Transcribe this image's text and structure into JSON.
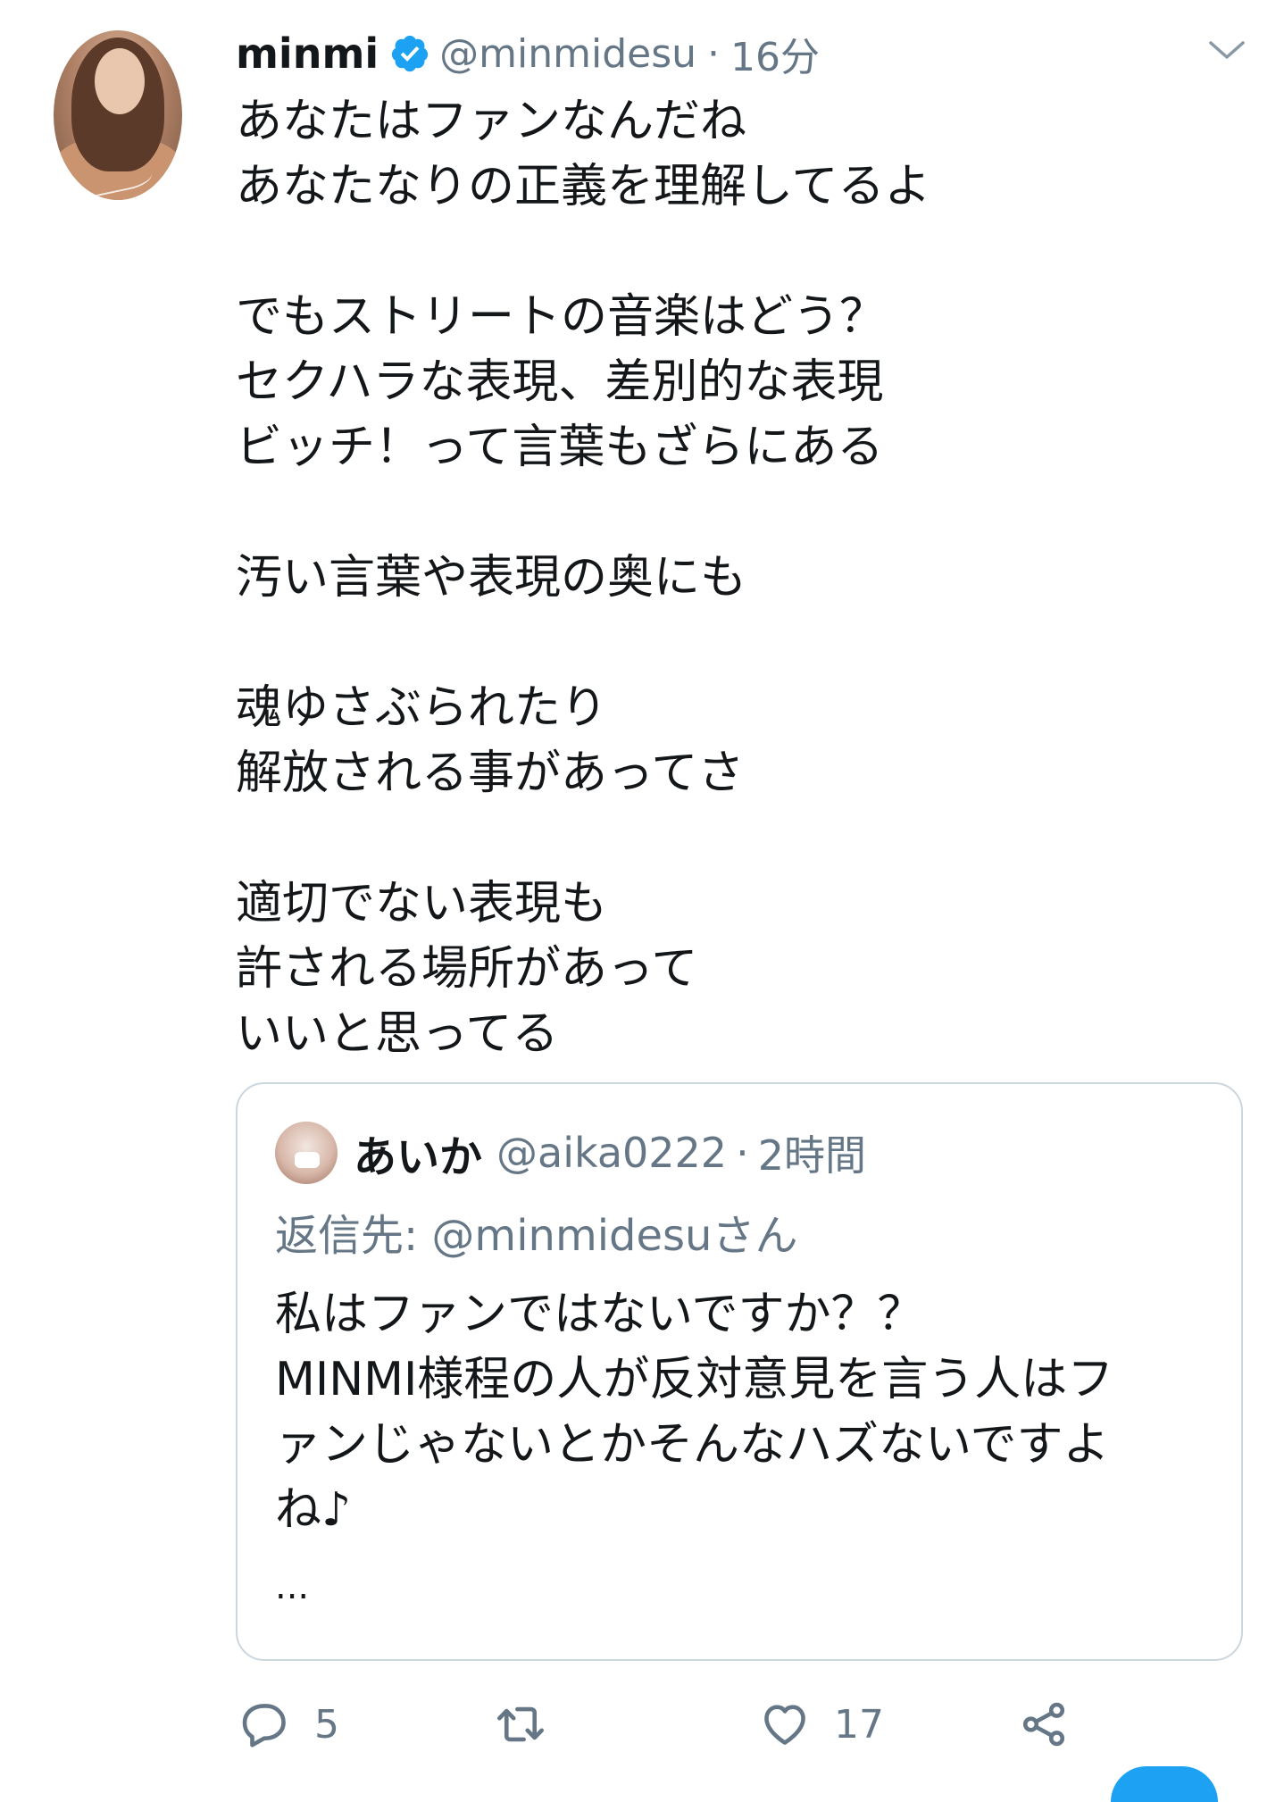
{
  "tweet": {
    "author_name": "minmi",
    "verified": true,
    "handle": "@minmidesu",
    "separator": "·",
    "time": "16分",
    "lines": [
      "あなたはファンなんだね",
      "あなたなりの正義を理解してるよ",
      "",
      "でもストリートの音楽はどう？",
      "セクハラな表現、差別的な表現",
      "ビッチ！って言葉もざらにある",
      "",
      "汚い言葉や表現の奥にも",
      "",
      "魂ゆさぶられたり",
      "解放される事があってさ",
      "",
      "適切でない表現も",
      "許される場所があって",
      "いいと思ってる"
    ]
  },
  "quoted_tweet": {
    "author_name": "あいか",
    "handle": "@aika0222",
    "separator": "·",
    "time": "2時間",
    "reply_to": "返信先: @minmidesuさん",
    "lines": [
      "私はファンではないですか？？",
      "MINMI様程の人が反対意見を言う人はフ",
      "ァンじゃないとかそんなハズないですよ",
      "ね♪"
    ],
    "ellipsis": "..."
  },
  "actions": {
    "reply_count": "5",
    "retweet_count": "",
    "like_count": "17"
  },
  "colors": {
    "text": "#14171a",
    "secondary": "#657786",
    "verified_blue": "#1da1f2",
    "border": "#ccd6dd"
  }
}
